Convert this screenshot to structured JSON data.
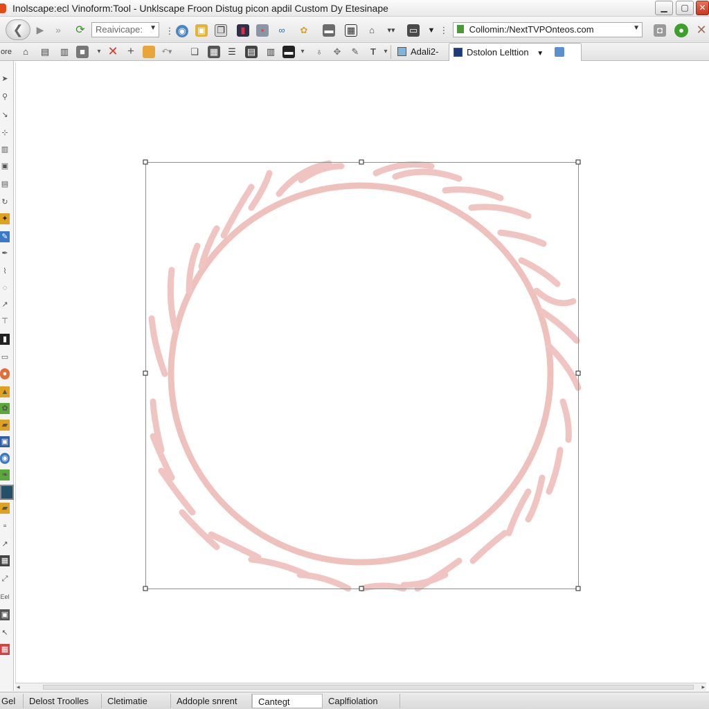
{
  "window": {
    "title": "Inolscape:ecl Vinoform:Tool - Unklscape Froon Distug picon apdil Custom Dy Etesinape",
    "minimize": "▁",
    "maximize": "▢",
    "close": "✕"
  },
  "toolbar1": {
    "back": "❮",
    "forward": "❯",
    "preset_combo": {
      "value": "Reaivicape:"
    },
    "address_combo": {
      "value": "Collomin:/NextTVPOnteos.com"
    }
  },
  "toolbar2": {
    "tab_1": "Adali2-",
    "tab_2": "Dstolon Lelttion"
  },
  "left_tools_label": "Eel",
  "statusbar": {
    "segments": [
      "Delost Troolles",
      "Cletimatie",
      "Addople snrent",
      "Cantegt",
      "Caplfiolation"
    ],
    "left_label": "Gel"
  },
  "colors": {
    "wreath_stroke": "#efc1bd",
    "selection": "#8f8f8f",
    "accent_red": "#d63a2a"
  },
  "icons": {
    "cut": "scissors-icon",
    "delete": "delete-x-icon",
    "add": "plus-icon",
    "text": "text-tool-icon"
  }
}
